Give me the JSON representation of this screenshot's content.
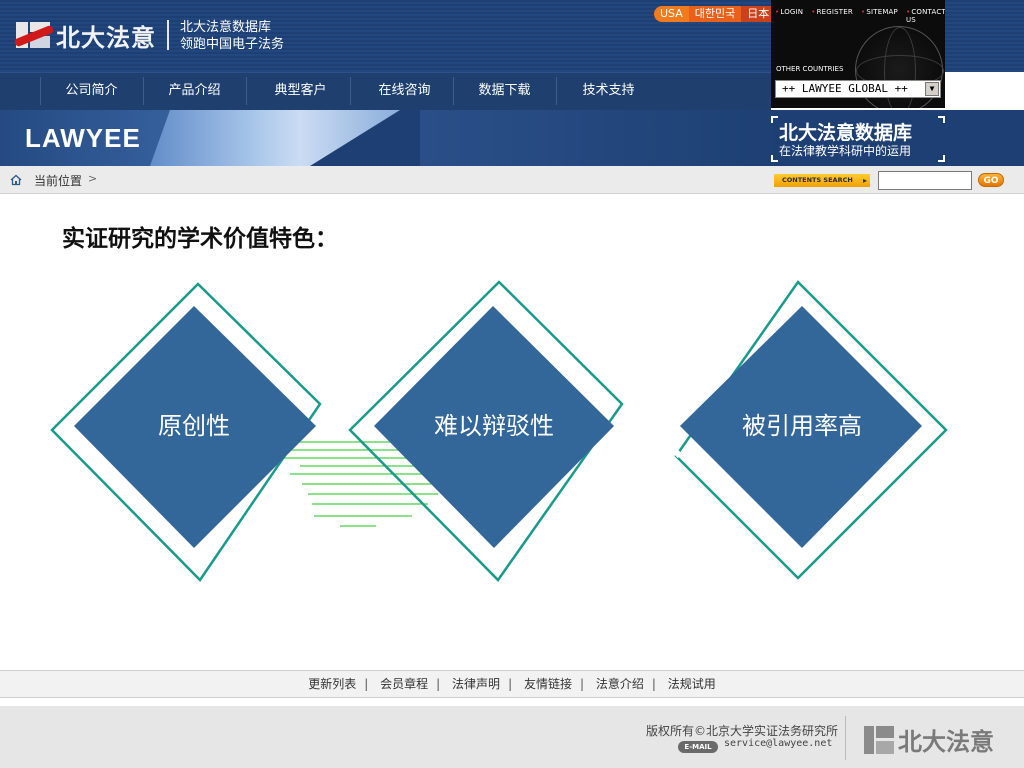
{
  "header": {
    "logo_text": "北大法意",
    "slogan_line1": "北大法意数据库",
    "slogan_line2": "领跑中国电子法务",
    "languages": [
      "USA",
      "대한민국",
      "日本"
    ],
    "top_links": [
      "LOGIN",
      "REGISTER",
      "SITEMAP",
      "CONTACT US"
    ],
    "other_countries": "OTHER COUNTRIES",
    "global_select": "++  LAWYEE GLOBAL  ++"
  },
  "nav": {
    "items": [
      "公司简介",
      "产品介绍",
      "典型客户",
      "在线咨询",
      "数据下载",
      "技术支持"
    ]
  },
  "banner": {
    "lawyee": "LAWYEE",
    "brand_title": "北大法意数据库",
    "brand_sub": "在法律教学科研中的运用"
  },
  "breadcrumb": {
    "label": "当前位置",
    "arrow": ">"
  },
  "search": {
    "button_label": "CONTENTS SEARCH",
    "go_label": "GO",
    "value": ""
  },
  "content": {
    "title": "实证研究的学术价值特色：",
    "diamonds": [
      "原创性",
      "难以辩驳性",
      "被引用率高"
    ]
  },
  "colors": {
    "diamond_fill": "#336699",
    "diamond_outline": "#1a9a8a",
    "streak": "#33cc33",
    "header_bg": "#1d3f73"
  },
  "footer": {
    "links": [
      "更新列表",
      "会员章程",
      "法律声明",
      "友情链接",
      "法意介绍",
      "法规试用"
    ],
    "copyright": "版权所有©北京大学实证法务研究所",
    "email_badge": "E-MAIL",
    "email": "service@lawyee.net",
    "logo_text": "北大法意"
  }
}
